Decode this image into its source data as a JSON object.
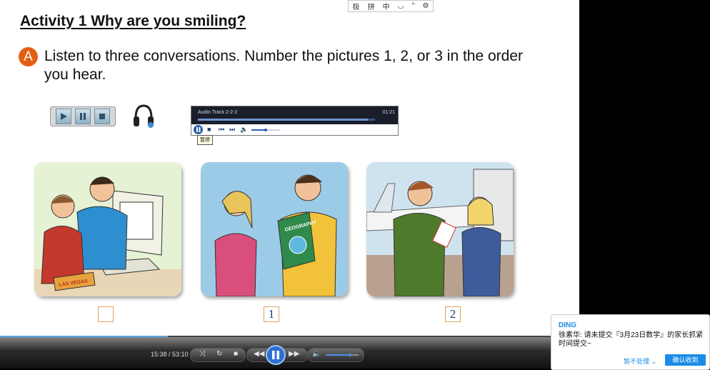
{
  "slide": {
    "title": "Activity 1  Why are you smiling?",
    "badge": "A",
    "instruction": "Listen to three conversations. Number the pictures 1, 2, or 3 in the order you hear."
  },
  "audio_player": {
    "track_title": "Audio Track 2-2-2",
    "track_time": "01:21",
    "progress": 0.96,
    "tooltip": "暂停"
  },
  "ime_toolbar": {
    "items": [
      "极",
      "拼",
      "中",
      "◡",
      "°",
      "⚙"
    ]
  },
  "pictures": [
    {
      "answer": "",
      "sign_text": "LAS VEGAS"
    },
    {
      "answer": "1",
      "book_text": "GEOGRAPHY"
    },
    {
      "answer": "2"
    }
  ],
  "video_player": {
    "time": "15:38 / 53:10",
    "progress": 0.29
  },
  "notification": {
    "sender": "DING",
    "message": "徐素华: 请未提交『3月23日数学』的家长抓紧时间提交~",
    "later_label": "暂不处理 ⌄",
    "confirm_label": "确认收到"
  },
  "colors": {
    "badge": "#e35f11",
    "accent": "#1a8ce6"
  }
}
